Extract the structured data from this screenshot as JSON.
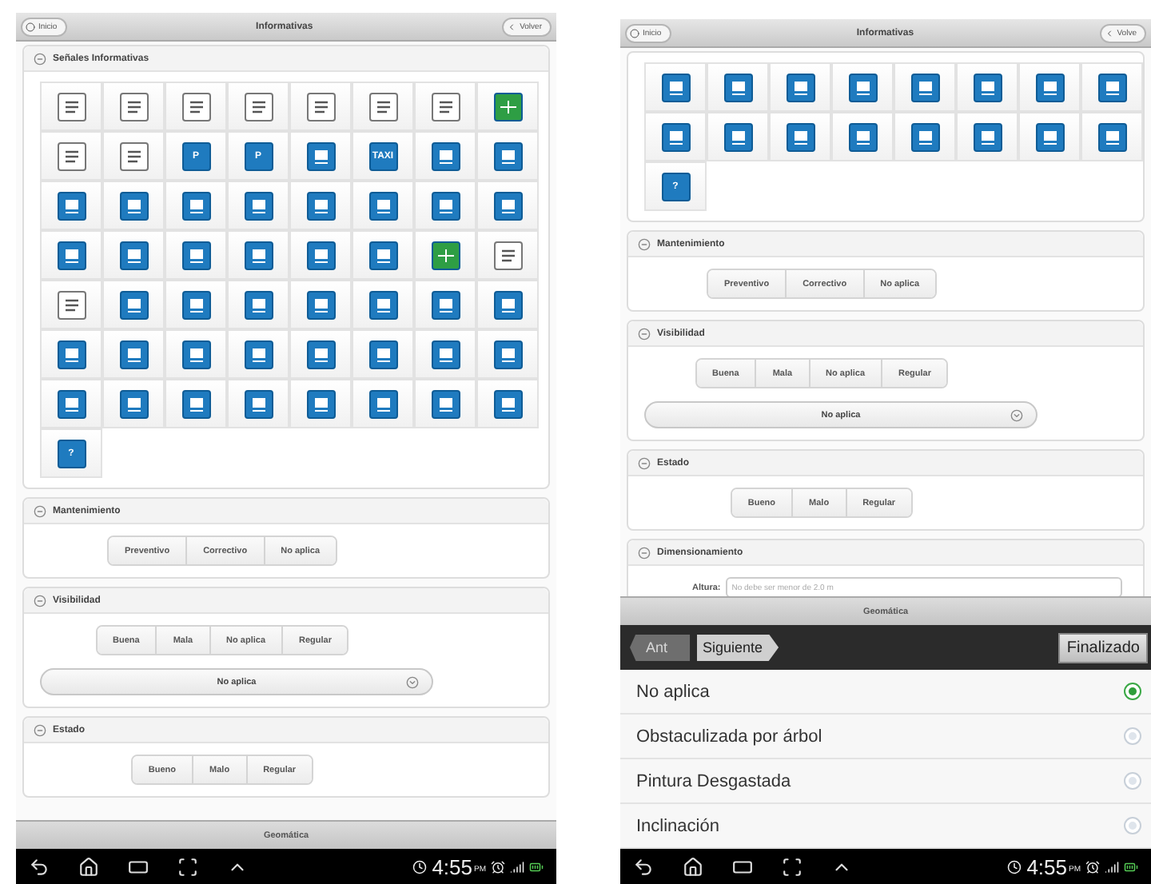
{
  "screens": [
    {
      "header": {
        "left_button": "Inicio",
        "title": "Informativas",
        "right_button": "Volver"
      },
      "sections": [
        {
          "kind": "signs",
          "title": "Señales Informativas",
          "signs": [
            {
              "kind": "white"
            },
            {
              "kind": "white"
            },
            {
              "kind": "white"
            },
            {
              "kind": "white"
            },
            {
              "kind": "white"
            },
            {
              "kind": "white"
            },
            {
              "kind": "white"
            },
            {
              "kind": "green"
            },
            {
              "kind": "white"
            },
            {
              "kind": "white"
            },
            {
              "kind": "blue",
              "label": "P"
            },
            {
              "kind": "blue",
              "label": "P"
            },
            {
              "kind": "blue"
            },
            {
              "kind": "blue",
              "label": "TAXI"
            },
            {
              "kind": "blue"
            },
            {
              "kind": "blue"
            },
            {
              "kind": "blue"
            },
            {
              "kind": "blue"
            },
            {
              "kind": "blue"
            },
            {
              "kind": "blue"
            },
            {
              "kind": "blue"
            },
            {
              "kind": "blue"
            },
            {
              "kind": "blue"
            },
            {
              "kind": "blue"
            },
            {
              "kind": "blue"
            },
            {
              "kind": "blue"
            },
            {
              "kind": "blue"
            },
            {
              "kind": "blue"
            },
            {
              "kind": "blue"
            },
            {
              "kind": "blue"
            },
            {
              "kind": "green"
            },
            {
              "kind": "white"
            },
            {
              "kind": "white"
            },
            {
              "kind": "blue"
            },
            {
              "kind": "blue"
            },
            {
              "kind": "blue"
            },
            {
              "kind": "blue"
            },
            {
              "kind": "blue"
            },
            {
              "kind": "blue"
            },
            {
              "kind": "blue"
            },
            {
              "kind": "blue"
            },
            {
              "kind": "blue"
            },
            {
              "kind": "blue"
            },
            {
              "kind": "blue"
            },
            {
              "kind": "blue"
            },
            {
              "kind": "blue"
            },
            {
              "kind": "blue"
            },
            {
              "kind": "blue"
            },
            {
              "kind": "blue"
            },
            {
              "kind": "blue"
            },
            {
              "kind": "blue"
            },
            {
              "kind": "blue"
            },
            {
              "kind": "blue"
            },
            {
              "kind": "blue"
            },
            {
              "kind": "blue"
            },
            {
              "kind": "blue"
            },
            {
              "kind": "blue",
              "label": "?"
            }
          ]
        },
        {
          "kind": "segmented",
          "title": "Mantenimiento",
          "options": [
            "Preventivo",
            "Correctivo",
            "No aplica"
          ]
        },
        {
          "kind": "segmented",
          "title": "Visibilidad",
          "options": [
            "Buena",
            "Mala",
            "No aplica",
            "Regular"
          ],
          "select": "No aplica"
        },
        {
          "kind": "segmented",
          "title": "Estado",
          "options": [
            "Bueno",
            "Malo",
            "Regular"
          ]
        }
      ],
      "footer": "Geomática",
      "status": {
        "time": "4:55",
        "meridiem": "PM"
      }
    },
    {
      "header": {
        "left_button": "Inicio",
        "title": "Informativas",
        "right_button": "Volve"
      },
      "sections": [
        {
          "kind": "signs",
          "signs": [
            {
              "kind": "blue"
            },
            {
              "kind": "blue"
            },
            {
              "kind": "blue"
            },
            {
              "kind": "blue"
            },
            {
              "kind": "blue"
            },
            {
              "kind": "blue"
            },
            {
              "kind": "blue"
            },
            {
              "kind": "blue"
            },
            {
              "kind": "blue"
            },
            {
              "kind": "blue"
            },
            {
              "kind": "blue"
            },
            {
              "kind": "blue"
            },
            {
              "kind": "blue"
            },
            {
              "kind": "blue"
            },
            {
              "kind": "blue"
            },
            {
              "kind": "blue"
            },
            {
              "kind": "blue",
              "label": "?"
            }
          ]
        },
        {
          "kind": "segmented",
          "title": "Mantenimiento",
          "options": [
            "Preventivo",
            "Correctivo",
            "No aplica"
          ]
        },
        {
          "kind": "segmented",
          "title": "Visibilidad",
          "options": [
            "Buena",
            "Mala",
            "No aplica",
            "Regular"
          ],
          "select": "No aplica"
        },
        {
          "kind": "segmented",
          "title": "Estado",
          "options": [
            "Bueno",
            "Malo",
            "Regular"
          ]
        },
        {
          "kind": "field",
          "title": "Dimensionamiento",
          "label": "Altura:",
          "placeholder": "No debe ser menor de 2.0 m"
        }
      ],
      "picker": {
        "title": "Geomática",
        "prev": {
          "label": "Ant",
          "disabled": true
        },
        "next": {
          "label": "Siguiente",
          "disabled": false
        },
        "done": "Finalizado",
        "options": [
          {
            "label": "No aplica",
            "selected": true
          },
          {
            "label": "Obstaculizada por árbol",
            "selected": false
          },
          {
            "label": "Pintura Desgastada",
            "selected": false
          },
          {
            "label": "Inclinación",
            "selected": false
          }
        ]
      },
      "status": {
        "time": "4:55",
        "meridiem": "PM"
      }
    }
  ]
}
